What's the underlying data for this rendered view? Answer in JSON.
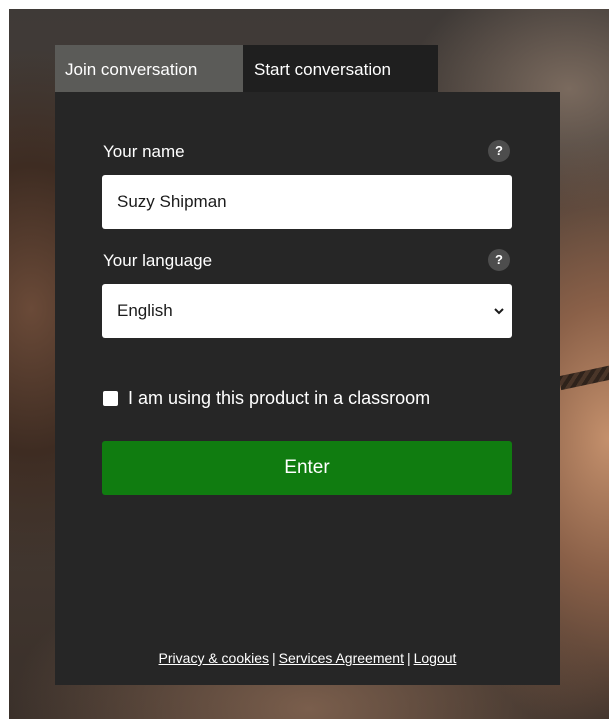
{
  "tabs": {
    "join": "Join conversation",
    "start": "Start conversation",
    "active": "start"
  },
  "form": {
    "name_label": "Your name",
    "name_value": "Suzy Shipman",
    "language_label": "Your language",
    "language_selected": "English",
    "help_glyph": "?",
    "classroom_checkbox_label": "I am using this product in a classroom",
    "classroom_checked": false,
    "enter_label": "Enter"
  },
  "footer": {
    "privacy": "Privacy & cookies",
    "separator": "|",
    "services": "Services Agreement",
    "logout": "Logout"
  },
  "colors": {
    "panel": "#262626",
    "tab_inactive": "#5b5b58",
    "tab_active": "#1f1f1f",
    "enter_button": "#107c10",
    "help_icon": "#4d4d4d"
  },
  "icons": {
    "help": "question-mark-icon",
    "select": "chevron-down-icon"
  }
}
